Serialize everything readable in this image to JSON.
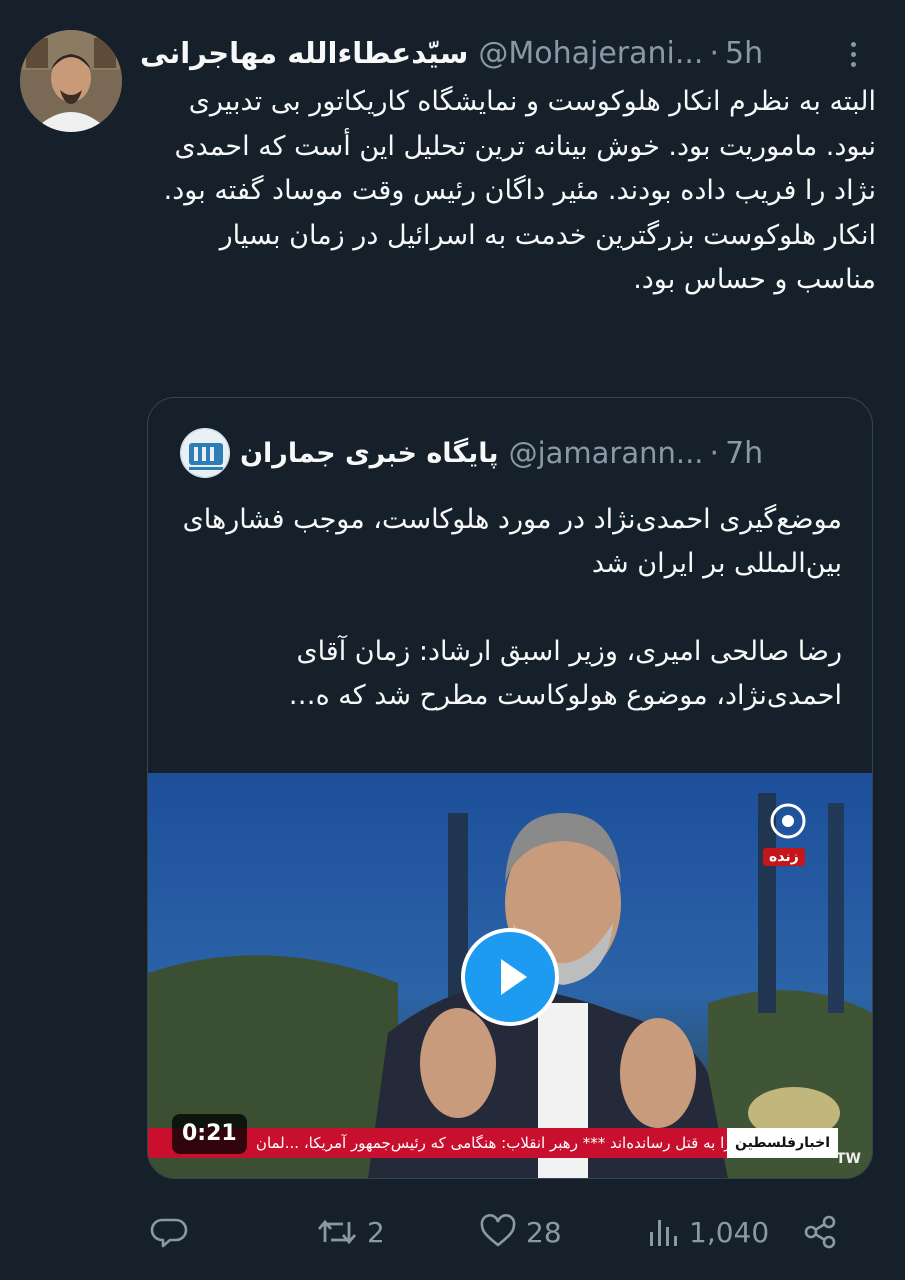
{
  "tweet": {
    "author_name": "سیّدعطاءالله مهاجرانی",
    "handle": "@Mohajerani...",
    "separator": "·",
    "time": "5h",
    "text": "البته به نظرم انکار هلوکوست و نمایشگاه کاریکاتور بی تدبیری نبود. ماموریت بود. خوش بینانه ترین تحلیل این أست که احمدی نژاد را فریب داده بودند. مئیر داگان رئیس وقت موساد گفته بود. انکار هلوکوست بزرگترین خدمت به اسرائیل در زمان بسیار مناسب و حساس بود."
  },
  "quote": {
    "author_name": "پایگاه خبری جماران",
    "handle": "@jamarann...",
    "separator": "·",
    "time": "7h",
    "paragraph1": "موضع‌گیری احمدی‌نژاد در مورد هلوکاست، موجب فشارهای بین‌المللی بر ایران شد",
    "paragraph2": "رضا صالحی امیری، وزیر اسبق ارشاد: زمان آقای احمدی‌نژاد، موضوع هولوکاست مطرح شد که ه…",
    "video": {
      "duration": "0:21",
      "live_label": "زنده",
      "ticker_label": "اخبارفلسطین",
      "ticker_text": "ی را به قتل رسانده‌اند *** رهبر انقلاب: هنگامی که رئیس‌جمهور آمریکا، ...لمان",
      "watermark": "TW"
    }
  },
  "actions": {
    "reply": {
      "icon": "reply-icon",
      "count": ""
    },
    "retweet": {
      "icon": "retweet-icon",
      "count": "2"
    },
    "like": {
      "icon": "heart-icon",
      "count": "28"
    },
    "views": {
      "icon": "views-icon",
      "count": "1,040"
    },
    "share": {
      "icon": "share-icon"
    }
  },
  "colors": {
    "background": "#15202b",
    "text": "#f7f9f9",
    "secondary": "#8b98a5",
    "accent": "#1d9bf0",
    "border": "#38444d"
  }
}
